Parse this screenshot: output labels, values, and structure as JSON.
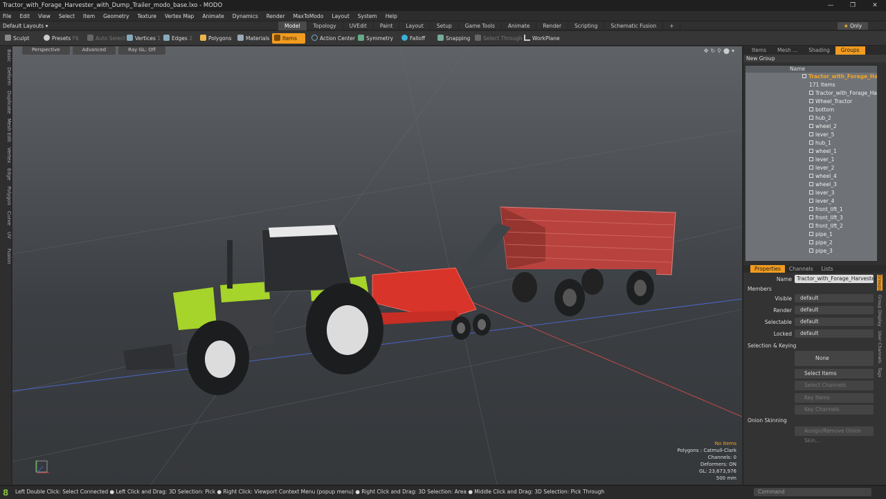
{
  "window": {
    "title": "Tractor_with_Forage_Harvester_with_Dump_Trailer_modo_base.lxo - MODO",
    "controls": [
      "—",
      "❐",
      "✕"
    ]
  },
  "menu": [
    "File",
    "Edit",
    "View",
    "Select",
    "Item",
    "Geometry",
    "Texture",
    "Vertex Map",
    "Animate",
    "Dynamics",
    "Render",
    "MaxToModo",
    "Layout",
    "System",
    "Help"
  ],
  "layout": {
    "default_layouts": "Default Layouts ▾",
    "tabs": [
      "Model",
      "Topology",
      "UVEdit",
      "Paint",
      "Layout",
      "Setup",
      "Game Tools",
      "Animate",
      "Render",
      "Scripting",
      "Schematic Fusion"
    ],
    "active_tab": "Model",
    "only": "Only"
  },
  "toolbar": {
    "sculpt": "Sculpt",
    "presets": "Presets",
    "presets_key": "F6",
    "auto_select": "Auto Select",
    "vertices": "Vertices",
    "vertices_key": "1",
    "edges": "Edges",
    "edges_key": "2",
    "polygons": "Polygons",
    "materials": "Materials",
    "items": "Items",
    "action_center": "Action Center",
    "symmetry": "Symmetry",
    "falloff": "Falloff",
    "snapping": "Snapping",
    "select_through": "Select Through",
    "workplane": "WorkPlane"
  },
  "left_tabs": [
    "Basic",
    "Deform",
    "Duplicate",
    "Mesh Edit",
    "Vertex",
    "Edge",
    "Polygon",
    "Curve",
    "UV",
    "Fusion"
  ],
  "viewport": {
    "perspective": "Perspective",
    "advanced": "Advanced",
    "raygl": "Ray GL: Off",
    "info": {
      "no_items": "No Items",
      "polygons": "Polygons : Catmull-Clark",
      "channels": "Channels: 0",
      "deformers": "Deformers: ON",
      "gl": "GL: 23,673,976",
      "scale": "500 mm"
    }
  },
  "groups_panel": {
    "tabs": [
      "Items",
      "Mesh ...",
      "Shading",
      "Groups"
    ],
    "active": "Groups",
    "new_group": "New Group",
    "name_header": "Name",
    "root": "Tractor_with_Forage_Har...",
    "root_count": "171 Items",
    "items": [
      "Tractor_with_Forage_Harve...",
      "Wheel_Tractor",
      "bottom",
      "hub_2",
      "wheel_2",
      "lever_5",
      "hub_1",
      "wheel_1",
      "lever_1",
      "lever_2",
      "wheel_4",
      "wheel_3",
      "lever_3",
      "lever_4",
      "front_lift_1",
      "front_lift_3",
      "front_lift_2",
      "pipe_1",
      "pipe_2",
      "pipe_3"
    ]
  },
  "properties": {
    "tabs": [
      "Properties",
      "Channels",
      "Lists"
    ],
    "active": "Properties",
    "name_label": "Name",
    "name_value": "Tractor_with_Forage_Harvester_",
    "members": "Members",
    "rows": [
      {
        "label": "Visible",
        "value": "default"
      },
      {
        "label": "Render",
        "value": "default"
      },
      {
        "label": "Selectable",
        "value": "default"
      },
      {
        "label": "Locked",
        "value": "default"
      }
    ],
    "selection_keying": "Selection & Keying",
    "none": "None",
    "select_items": "Select Items",
    "select_channels": "Select Channels",
    "key_items": "Key Items",
    "key_channels": "Key Channels",
    "onion": "Onion Skinning",
    "assign_remove": "Assign/Remove Onion Skin...",
    "side_tabs": [
      "Groups",
      "Group Display",
      "User Channels",
      "Tags"
    ]
  },
  "status": {
    "text": "Left Double Click: Select Connected ● Left Click and Drag: 3D Selection: Pick ● Right Click: Viewport Context Menu (popup menu) ● Right Click and Drag: 3D Selection: Area ● Middle Click and Drag: 3D Selection: Pick Through",
    "command": "Command"
  },
  "colors": {
    "accent": "#f29b1e",
    "tractor_green": "#a6d42a",
    "harvester_red": "#d8342a",
    "trailer_red": "#b8433e"
  }
}
